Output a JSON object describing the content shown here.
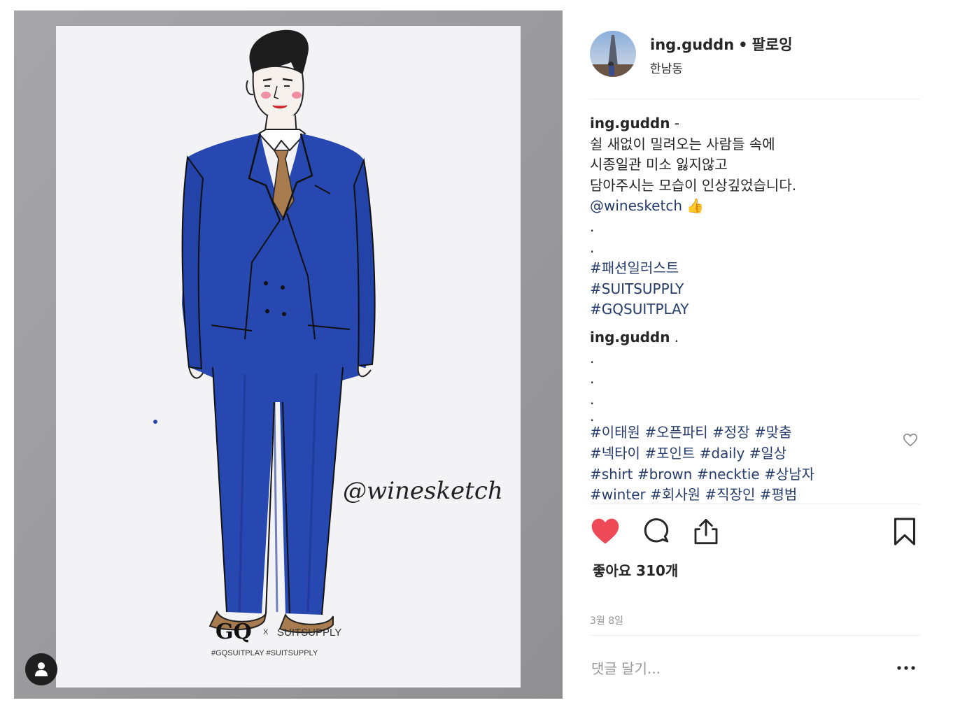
{
  "post": {
    "photo": {
      "watermark": "@winesketch",
      "brand_main": "GQ",
      "brand_x": "X",
      "brand_partner": "SUITSUPPLY",
      "brand_tags": "#GQSUITPLAY #SUITSUPPLY",
      "tag_users_icon": "person-icon"
    },
    "header": {
      "username": "ing.guddn",
      "separator": "•",
      "follow_status": "팔로잉",
      "location": "한남동"
    },
    "caption": {
      "username": "ing.guddn",
      "first_line": "-",
      "lines": [
        "쉴 새없이 밀려오는 사람들 속에",
        "시종일관 미소 잃지않고",
        "담아주시는 모습이 인상깊었습니다."
      ],
      "mention": "@winesketch",
      "mention_emoji": "👍",
      "dots": [
        ".",
        "."
      ],
      "hashtags": [
        "#패션일러스트",
        "#SUITSUPPLY",
        "#GQSUITPLAY"
      ]
    },
    "comment": {
      "username": "ing.guddn",
      "first_line": ".",
      "dots": [
        ".",
        ".",
        ".",
        "."
      ],
      "hashtag_lines": [
        "#이태원 #오픈파티 #정장 #맞춤",
        "#넥타이 #포인트 #daily #일상",
        "#shirt #brown #necktie #상남자",
        "#winter #회사원 #직장인 #평범"
      ]
    },
    "actions": {
      "like_icon": "heart-filled-icon",
      "comment_icon": "comment-bubble-icon",
      "share_icon": "share-icon",
      "save_icon": "bookmark-icon",
      "liked": true
    },
    "likes_text": "좋아요 310개",
    "date": "3월 8일",
    "comment_placeholder": "댓글 달기...",
    "more_label": "…"
  },
  "colors": {
    "like_red": "#ed4956",
    "link_blue": "#263d6b",
    "text": "#262626",
    "muted": "#999999",
    "suit_blue": "#2748b0",
    "tie_brown": "#a87c4f"
  }
}
